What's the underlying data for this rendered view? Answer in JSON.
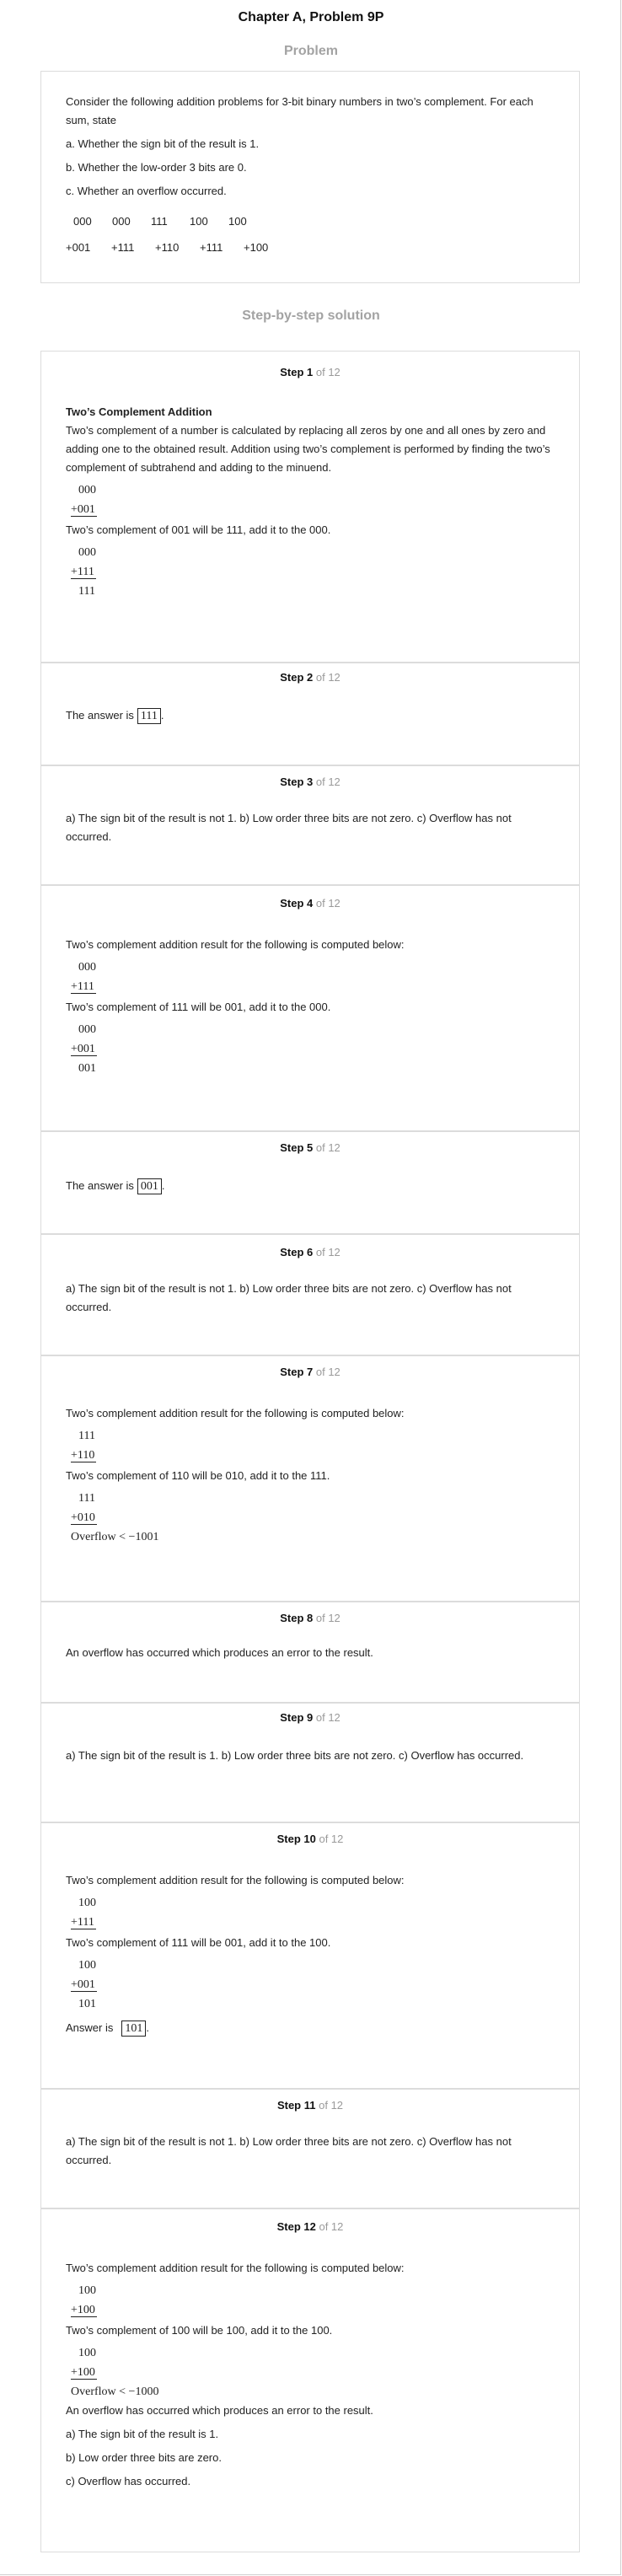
{
  "header": {
    "title": "Chapter A, Problem 9P"
  },
  "problem": {
    "heading": "Problem",
    "intro": "Consider the following addition problems for 3-bit binary numbers in two’s complement. For each sum, state",
    "items": [
      "a. Whether the sign bit of the result is 1.",
      "b. Whether the low-order 3 bits are 0.",
      "c. Whether an overflow occurred."
    ],
    "operands_top": [
      "000",
      "000",
      "111",
      "100",
      "100"
    ],
    "operands_bottom": [
      "+001",
      "+111",
      "+110",
      "+111",
      "+100"
    ]
  },
  "solution": {
    "heading": "Step-by-step solution"
  },
  "steps": [
    {
      "label": "Step 1",
      "of": "of 12",
      "title": "Two’s Complement Addition",
      "text": "Two’s complement of a number is calculated by replacing all zeros by one and all ones by zero and adding one to the obtained result. Addition using two’s complement is performed by finding the two’s complement of subtrahend and adding to the minuend.",
      "calc1": [
        "000",
        "+001"
      ],
      "text2": "Two’s complement of 001 will be 111, add it to the 000.",
      "calc2": [
        "000",
        "+111",
        "111"
      ]
    },
    {
      "label": "Step 2",
      "of": "of 12",
      "text": "The answer is",
      "answer": "111"
    },
    {
      "label": "Step 3",
      "of": "of 12",
      "text": "a) The sign bit of the result is not 1. b) Low order three bits are not zero. c) Overflow has not occurred."
    },
    {
      "label": "Step 4",
      "of": "of 12",
      "text": "Two’s complement addition result for the following is computed below:",
      "calc1": [
        "000",
        "+111"
      ],
      "text2": "Two’s complement of 111 will be 001, add it to the 000.",
      "calc2": [
        "000",
        "+001",
        "001"
      ]
    },
    {
      "label": "Step 5",
      "of": "of 12",
      "text": "The answer is",
      "answer": "001"
    },
    {
      "label": "Step 6",
      "of": "of 12",
      "text": "a) The sign bit of the result is not 1. b) Low order three bits are not zero. c) Overflow has not occurred."
    },
    {
      "label": "Step 7",
      "of": "of 12",
      "text": "Two’s complement addition result for the following is computed below:",
      "calc1": [
        "111",
        "+110"
      ],
      "text2": "Two’s complement of 110 will be 010, add it to the 111.",
      "calc2": [
        "111",
        "+010",
        "Overflow < −1001"
      ]
    },
    {
      "label": "Step 8",
      "of": "of 12",
      "text": "An overflow has occurred which produces an error to the result."
    },
    {
      "label": "Step 9",
      "of": "of 12",
      "text": "a) The sign bit of the result is 1. b) Low order three bits are not zero. c) Overflow has occurred."
    },
    {
      "label": "Step 10",
      "of": "of 12",
      "text": "Two’s complement addition result for the following is computed below:",
      "calc1": [
        "100",
        "+111"
      ],
      "text2": "Two’s complement of 111 will be 001, add it to the 100.",
      "calc2": [
        "100",
        "+001",
        "101"
      ],
      "answer_label": "Answer is",
      "answer": "101"
    },
    {
      "label": "Step 11",
      "of": "of 12",
      "text": "a) The sign bit of the result is not 1. b) Low order three bits are not zero. c) Overflow has not occurred."
    },
    {
      "label": "Step 12",
      "of": "of 12",
      "text": "Two’s complement addition result for the following is computed below:",
      "calc1": [
        "100",
        "+100"
      ],
      "text2": "Two’s complement of 100 will be 100, add it to the 100.",
      "calc2": [
        "100",
        "+100",
        "Overflow < −1000"
      ],
      "text3": "An overflow has occurred which produces an error to the result.",
      "items": [
        "a) The sign bit of the result is 1.",
        "b) Low order three bits are zero.",
        "c) Overflow has occurred."
      ]
    }
  ]
}
